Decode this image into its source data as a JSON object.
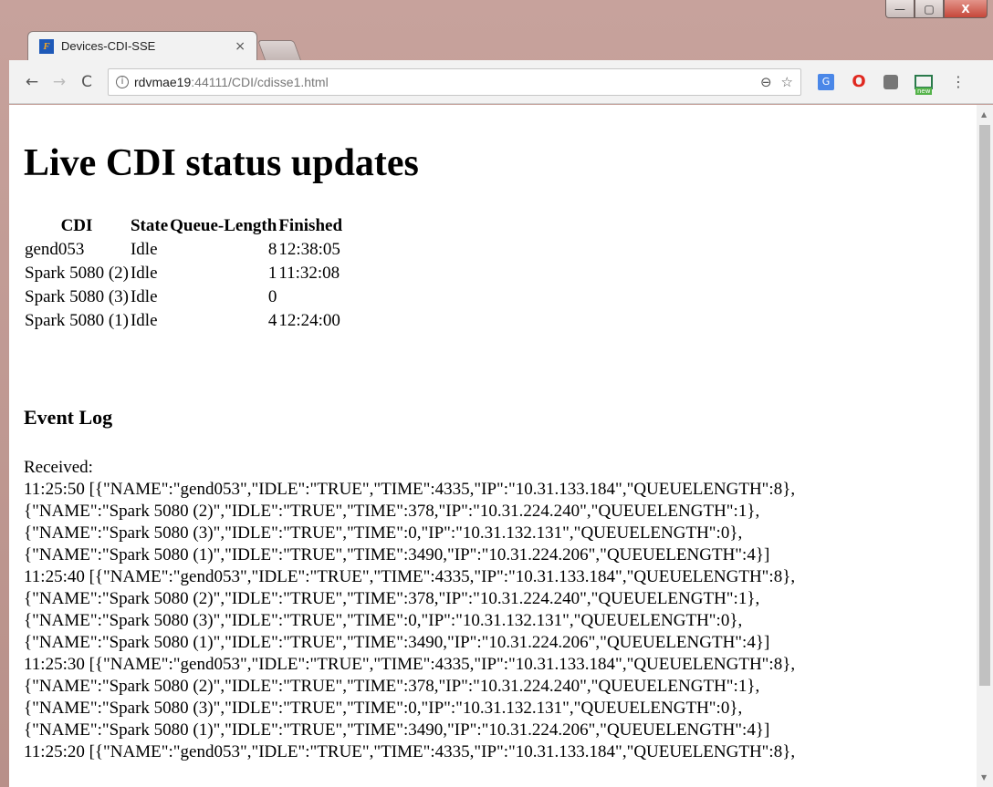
{
  "window": {
    "minimize_glyph": "—",
    "maximize_glyph": "▢",
    "close_glyph": "X"
  },
  "tab": {
    "favicon_letter": "F",
    "title": "Devices-CDI-SSE",
    "close_glyph": "×"
  },
  "toolbar": {
    "back_glyph": "←",
    "forward_glyph": "→",
    "reload_glyph": "C",
    "info_glyph": "i",
    "url_host": "rdvmae19",
    "url_rest": ":44111/CDI/cdisse1.html",
    "zoom_glyph": "⊖",
    "star_glyph": "☆",
    "ext_translate": "G",
    "ext_opera": "O",
    "ext_new_badge": "new",
    "menu_glyph": "⋮"
  },
  "page": {
    "heading": "Live CDI status updates",
    "table": {
      "headers": [
        "CDI",
        "State",
        "Queue-Length",
        "Finished"
      ],
      "rows": [
        [
          "gend053",
          "Idle",
          "8",
          "12:38:05"
        ],
        [
          "Spark 5080 (2)",
          "Idle",
          "1",
          "11:32:08"
        ],
        [
          "Spark 5080 (3)",
          "Idle",
          "0",
          ""
        ],
        [
          "Spark 5080 (1)",
          "Idle",
          "4",
          "12:24:00"
        ]
      ]
    },
    "event_log_title": "Event Log",
    "received_label": "Received:",
    "log_lines": [
      "11:25:50 [{\"NAME\":\"gend053\",\"IDLE\":\"TRUE\",\"TIME\":4335,\"IP\":\"10.31.133.184\",\"QUEUELENGTH\":8},",
      "{\"NAME\":\"Spark 5080 (2)\",\"IDLE\":\"TRUE\",\"TIME\":378,\"IP\":\"10.31.224.240\",\"QUEUELENGTH\":1},",
      "{\"NAME\":\"Spark 5080 (3)\",\"IDLE\":\"TRUE\",\"TIME\":0,\"IP\":\"10.31.132.131\",\"QUEUELENGTH\":0},",
      "{\"NAME\":\"Spark 5080 (1)\",\"IDLE\":\"TRUE\",\"TIME\":3490,\"IP\":\"10.31.224.206\",\"QUEUELENGTH\":4}]",
      "11:25:40 [{\"NAME\":\"gend053\",\"IDLE\":\"TRUE\",\"TIME\":4335,\"IP\":\"10.31.133.184\",\"QUEUELENGTH\":8},",
      "{\"NAME\":\"Spark 5080 (2)\",\"IDLE\":\"TRUE\",\"TIME\":378,\"IP\":\"10.31.224.240\",\"QUEUELENGTH\":1},",
      "{\"NAME\":\"Spark 5080 (3)\",\"IDLE\":\"TRUE\",\"TIME\":0,\"IP\":\"10.31.132.131\",\"QUEUELENGTH\":0},",
      "{\"NAME\":\"Spark 5080 (1)\",\"IDLE\":\"TRUE\",\"TIME\":3490,\"IP\":\"10.31.224.206\",\"QUEUELENGTH\":4}]",
      "11:25:30 [{\"NAME\":\"gend053\",\"IDLE\":\"TRUE\",\"TIME\":4335,\"IP\":\"10.31.133.184\",\"QUEUELENGTH\":8},",
      "{\"NAME\":\"Spark 5080 (2)\",\"IDLE\":\"TRUE\",\"TIME\":378,\"IP\":\"10.31.224.240\",\"QUEUELENGTH\":1},",
      "{\"NAME\":\"Spark 5080 (3)\",\"IDLE\":\"TRUE\",\"TIME\":0,\"IP\":\"10.31.132.131\",\"QUEUELENGTH\":0},",
      "{\"NAME\":\"Spark 5080 (1)\",\"IDLE\":\"TRUE\",\"TIME\":3490,\"IP\":\"10.31.224.206\",\"QUEUELENGTH\":4}]",
      "11:25:20 [{\"NAME\":\"gend053\",\"IDLE\":\"TRUE\",\"TIME\":4335,\"IP\":\"10.31.133.184\",\"QUEUELENGTH\":8},"
    ]
  },
  "scrollbar": {
    "up_glyph": "▲",
    "down_glyph": "▼"
  }
}
